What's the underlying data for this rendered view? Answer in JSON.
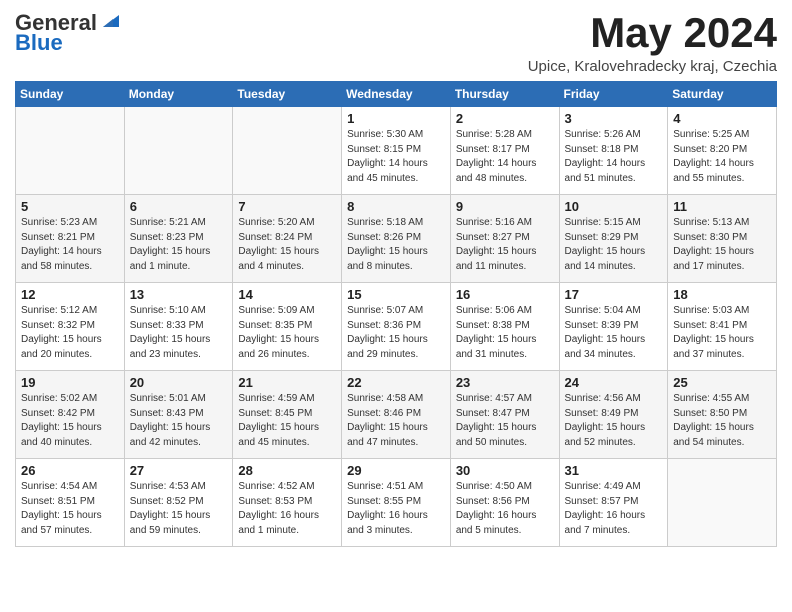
{
  "logo": {
    "general": "General",
    "blue": "Blue"
  },
  "title": "May 2024",
  "subtitle": "Upice, Kralovehradecky kraj, Czechia",
  "days_header": [
    "Sunday",
    "Monday",
    "Tuesday",
    "Wednesday",
    "Thursday",
    "Friday",
    "Saturday"
  ],
  "weeks": [
    [
      {
        "day": "",
        "info": ""
      },
      {
        "day": "",
        "info": ""
      },
      {
        "day": "",
        "info": ""
      },
      {
        "day": "1",
        "info": "Sunrise: 5:30 AM\nSunset: 8:15 PM\nDaylight: 14 hours\nand 45 minutes."
      },
      {
        "day": "2",
        "info": "Sunrise: 5:28 AM\nSunset: 8:17 PM\nDaylight: 14 hours\nand 48 minutes."
      },
      {
        "day": "3",
        "info": "Sunrise: 5:26 AM\nSunset: 8:18 PM\nDaylight: 14 hours\nand 51 minutes."
      },
      {
        "day": "4",
        "info": "Sunrise: 5:25 AM\nSunset: 8:20 PM\nDaylight: 14 hours\nand 55 minutes."
      }
    ],
    [
      {
        "day": "5",
        "info": "Sunrise: 5:23 AM\nSunset: 8:21 PM\nDaylight: 14 hours\nand 58 minutes."
      },
      {
        "day": "6",
        "info": "Sunrise: 5:21 AM\nSunset: 8:23 PM\nDaylight: 15 hours\nand 1 minute."
      },
      {
        "day": "7",
        "info": "Sunrise: 5:20 AM\nSunset: 8:24 PM\nDaylight: 15 hours\nand 4 minutes."
      },
      {
        "day": "8",
        "info": "Sunrise: 5:18 AM\nSunset: 8:26 PM\nDaylight: 15 hours\nand 8 minutes."
      },
      {
        "day": "9",
        "info": "Sunrise: 5:16 AM\nSunset: 8:27 PM\nDaylight: 15 hours\nand 11 minutes."
      },
      {
        "day": "10",
        "info": "Sunrise: 5:15 AM\nSunset: 8:29 PM\nDaylight: 15 hours\nand 14 minutes."
      },
      {
        "day": "11",
        "info": "Sunrise: 5:13 AM\nSunset: 8:30 PM\nDaylight: 15 hours\nand 17 minutes."
      }
    ],
    [
      {
        "day": "12",
        "info": "Sunrise: 5:12 AM\nSunset: 8:32 PM\nDaylight: 15 hours\nand 20 minutes."
      },
      {
        "day": "13",
        "info": "Sunrise: 5:10 AM\nSunset: 8:33 PM\nDaylight: 15 hours\nand 23 minutes."
      },
      {
        "day": "14",
        "info": "Sunrise: 5:09 AM\nSunset: 8:35 PM\nDaylight: 15 hours\nand 26 minutes."
      },
      {
        "day": "15",
        "info": "Sunrise: 5:07 AM\nSunset: 8:36 PM\nDaylight: 15 hours\nand 29 minutes."
      },
      {
        "day": "16",
        "info": "Sunrise: 5:06 AM\nSunset: 8:38 PM\nDaylight: 15 hours\nand 31 minutes."
      },
      {
        "day": "17",
        "info": "Sunrise: 5:04 AM\nSunset: 8:39 PM\nDaylight: 15 hours\nand 34 minutes."
      },
      {
        "day": "18",
        "info": "Sunrise: 5:03 AM\nSunset: 8:41 PM\nDaylight: 15 hours\nand 37 minutes."
      }
    ],
    [
      {
        "day": "19",
        "info": "Sunrise: 5:02 AM\nSunset: 8:42 PM\nDaylight: 15 hours\nand 40 minutes."
      },
      {
        "day": "20",
        "info": "Sunrise: 5:01 AM\nSunset: 8:43 PM\nDaylight: 15 hours\nand 42 minutes."
      },
      {
        "day": "21",
        "info": "Sunrise: 4:59 AM\nSunset: 8:45 PM\nDaylight: 15 hours\nand 45 minutes."
      },
      {
        "day": "22",
        "info": "Sunrise: 4:58 AM\nSunset: 8:46 PM\nDaylight: 15 hours\nand 47 minutes."
      },
      {
        "day": "23",
        "info": "Sunrise: 4:57 AM\nSunset: 8:47 PM\nDaylight: 15 hours\nand 50 minutes."
      },
      {
        "day": "24",
        "info": "Sunrise: 4:56 AM\nSunset: 8:49 PM\nDaylight: 15 hours\nand 52 minutes."
      },
      {
        "day": "25",
        "info": "Sunrise: 4:55 AM\nSunset: 8:50 PM\nDaylight: 15 hours\nand 54 minutes."
      }
    ],
    [
      {
        "day": "26",
        "info": "Sunrise: 4:54 AM\nSunset: 8:51 PM\nDaylight: 15 hours\nand 57 minutes."
      },
      {
        "day": "27",
        "info": "Sunrise: 4:53 AM\nSunset: 8:52 PM\nDaylight: 15 hours\nand 59 minutes."
      },
      {
        "day": "28",
        "info": "Sunrise: 4:52 AM\nSunset: 8:53 PM\nDaylight: 16 hours\nand 1 minute."
      },
      {
        "day": "29",
        "info": "Sunrise: 4:51 AM\nSunset: 8:55 PM\nDaylight: 16 hours\nand 3 minutes."
      },
      {
        "day": "30",
        "info": "Sunrise: 4:50 AM\nSunset: 8:56 PM\nDaylight: 16 hours\nand 5 minutes."
      },
      {
        "day": "31",
        "info": "Sunrise: 4:49 AM\nSunset: 8:57 PM\nDaylight: 16 hours\nand 7 minutes."
      },
      {
        "day": "",
        "info": ""
      }
    ]
  ]
}
